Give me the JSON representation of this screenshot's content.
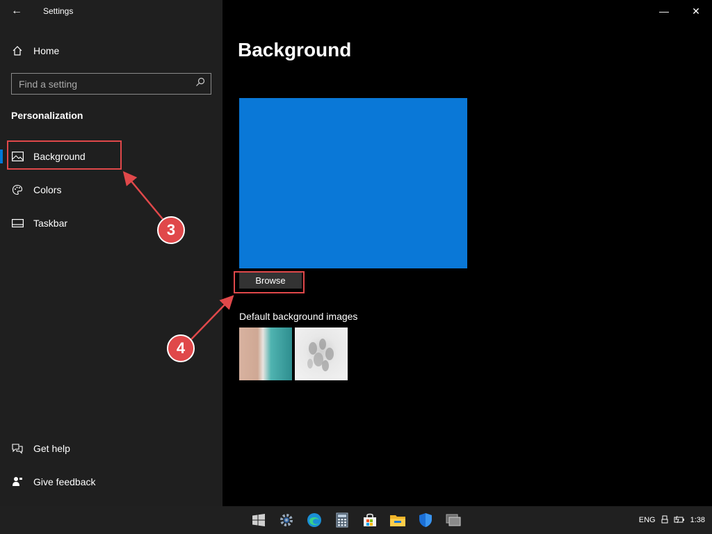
{
  "window": {
    "title": "Settings",
    "minimize_glyph": "—",
    "close_glyph": "✕",
    "back_glyph": "←"
  },
  "sidebar": {
    "home_label": "Home",
    "search": {
      "placeholder": "Find a setting",
      "value": ""
    },
    "section_heading": "Personalization",
    "items": [
      {
        "label": "Background",
        "icon": "picture-icon",
        "active": true
      },
      {
        "label": "Colors",
        "icon": "palette-icon",
        "active": false
      },
      {
        "label": "Taskbar",
        "icon": "taskbar-icon",
        "active": false
      }
    ],
    "footer": [
      {
        "label": "Get help",
        "icon": "help-chat-icon"
      },
      {
        "label": "Give feedback",
        "icon": "feedback-icon"
      }
    ]
  },
  "main": {
    "page_title": "Background",
    "preview_color": "#0a78d7",
    "browse_label": "Browse",
    "default_images_label": "Default background images",
    "thumbnails": [
      "beach-aerial-image",
      "abstract-white-image"
    ]
  },
  "annotations": [
    {
      "number": "3",
      "color": "#e0484a"
    },
    {
      "number": "4",
      "color": "#e0484a"
    }
  ],
  "taskbar": {
    "apps": [
      "start-icon",
      "settings-gear-icon",
      "edge-icon",
      "calculator-icon",
      "store-icon",
      "file-explorer-icon",
      "defender-shield-icon",
      "task-view-icon"
    ],
    "tray": {
      "language": "ENG",
      "time": "1:38"
    }
  },
  "colors": {
    "accent": "#0078d7",
    "sidebar_bg": "#1f1f1f",
    "main_bg": "#000000",
    "annotation": "#e0484a"
  }
}
